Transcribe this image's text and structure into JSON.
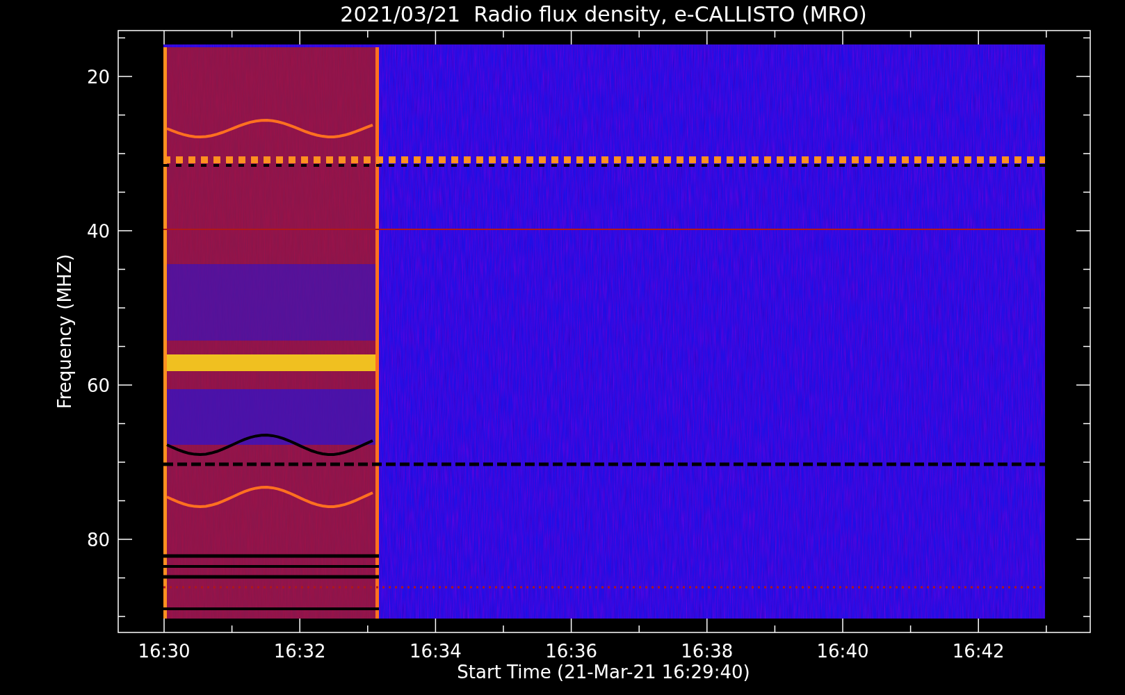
{
  "chart": {
    "title": "2021/03/21  Radio flux density, e-CALLISTO (MRO)",
    "ylabel": "Frequency (MHZ)",
    "xlabel": "Start Time (21-Mar-21 16:29:40)",
    "yticks": [
      "20",
      "40",
      "60",
      "80"
    ],
    "xticks": [
      "16:30",
      "16:32",
      "16:34",
      "16:36",
      "16:38",
      "16:40",
      "16:42"
    ]
  }
}
